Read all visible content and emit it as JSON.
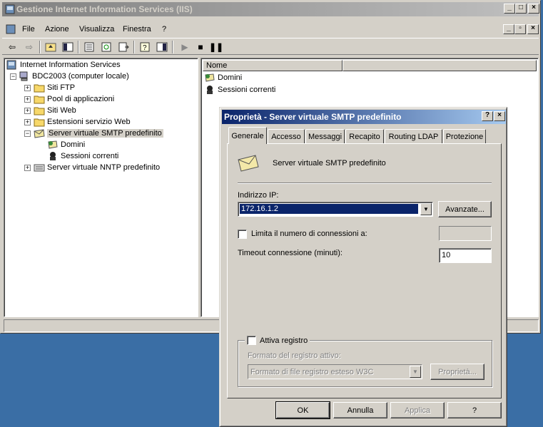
{
  "mmc": {
    "title": "Gestione Internet Information Services (IIS)",
    "menu": [
      "File",
      "Azione",
      "Visualizza",
      "Finestra",
      "?"
    ],
    "tree": {
      "root": "Internet Information Services",
      "computer": "BDC2003 (computer locale)",
      "items": [
        "Siti FTP",
        "Pool di applicazioni",
        "Siti Web",
        "Estensioni servizio Web",
        "Server virtuale SMTP predefinito",
        "Domini",
        "Sessioni correnti",
        "Server virtuale NNTP predefinito"
      ]
    },
    "list": {
      "column": "Nome",
      "items": [
        "Domini",
        "Sessioni correnti"
      ]
    }
  },
  "dialog": {
    "title": "Proprietà - Server virtuale SMTP predefinito",
    "tabs": [
      "Generale",
      "Accesso",
      "Messaggi",
      "Recapito",
      "Routing LDAP",
      "Protezione"
    ],
    "server_name": "Server virtuale SMTP predefinito",
    "ip_label": "Indirizzo IP:",
    "ip_value": "172.16.1.2",
    "advanced_button": "Avanzate...",
    "limit_label": "Limita il numero di connessioni a:",
    "limit_value": "",
    "timeout_label": "Timeout connessione (minuti):",
    "timeout_value": "10",
    "log_enable_label": "Attiva registro",
    "log_format_label": "Formato del registro attivo:",
    "log_format_value": "Formato di file registro esteso W3C",
    "properties_button": "Proprietà...",
    "ok": "OK",
    "cancel": "Annulla",
    "apply": "Applica",
    "help": "?"
  }
}
